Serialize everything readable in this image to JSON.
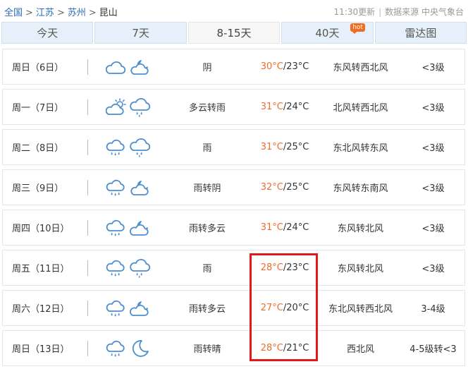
{
  "breadcrumb": {
    "items": [
      "全国",
      "江苏",
      "苏州"
    ],
    "current": "昆山"
  },
  "meta": {
    "update_time": "11:30更新",
    "source": "数据来源 中央气象台"
  },
  "tabs": [
    {
      "label": "今天",
      "active": false
    },
    {
      "label": "7天",
      "active": false
    },
    {
      "label": "8-15天",
      "active": true
    },
    {
      "label": "40天",
      "active": false,
      "badge": "hot"
    },
    {
      "label": "雷达图",
      "active": false
    }
  ],
  "forecast": [
    {
      "day": "周日（6日）",
      "icons": [
        "cloudy-icon",
        "partly-cloudy-night-icon"
      ],
      "condition": "阴",
      "high": "30°C",
      "low": "/23°C",
      "wind": "东风转西北风",
      "level": "<3级"
    },
    {
      "day": "周一（7日）",
      "icons": [
        "partly-cloudy-day-icon",
        "shower-icon"
      ],
      "condition": "多云转雨",
      "high": "31°C",
      "low": "/24°C",
      "wind": "北风转西北风",
      "level": "<3级"
    },
    {
      "day": "周二（8日）",
      "icons": [
        "rain-icon",
        "shower-icon"
      ],
      "condition": "雨",
      "high": "31°C",
      "low": "/25°C",
      "wind": "东北风转东风",
      "level": "<3级"
    },
    {
      "day": "周三（9日）",
      "icons": [
        "rain-icon",
        "partly-cloudy-night-icon"
      ],
      "condition": "雨转阴",
      "high": "32°C",
      "low": "/25°C",
      "wind": "东风转东南风",
      "level": "<3级"
    },
    {
      "day": "周四（10日）",
      "icons": [
        "rain-icon",
        "cloudy-night-icon"
      ],
      "condition": "雨转多云",
      "high": "31°C",
      "low": "/24°C",
      "wind": "东风转北风",
      "level": "<3级"
    },
    {
      "day": "周五（11日）",
      "icons": [
        "rain-icon",
        "shower-icon"
      ],
      "condition": "雨",
      "high": "28°C",
      "low": "/23°C",
      "wind": "东风转北风",
      "level": "<3级"
    },
    {
      "day": "周六（12日）",
      "icons": [
        "rain-icon",
        "cloudy-night-icon"
      ],
      "condition": "雨转多云",
      "high": "27°C",
      "low": "/20°C",
      "wind": "东北风转西北风",
      "level": "3-4级"
    },
    {
      "day": "周日（13日）",
      "icons": [
        "rain-icon",
        "moon-icon"
      ],
      "condition": "雨转晴",
      "high": "28°C",
      "low": "/21°C",
      "wind": "西北风",
      "level": "4-5级转<3"
    }
  ],
  "colors": {
    "accent": "#2b6cb5",
    "temp_high": "#f26c2e",
    "highlight": "#e0191c",
    "icon_stroke": "#4d8ecf"
  }
}
